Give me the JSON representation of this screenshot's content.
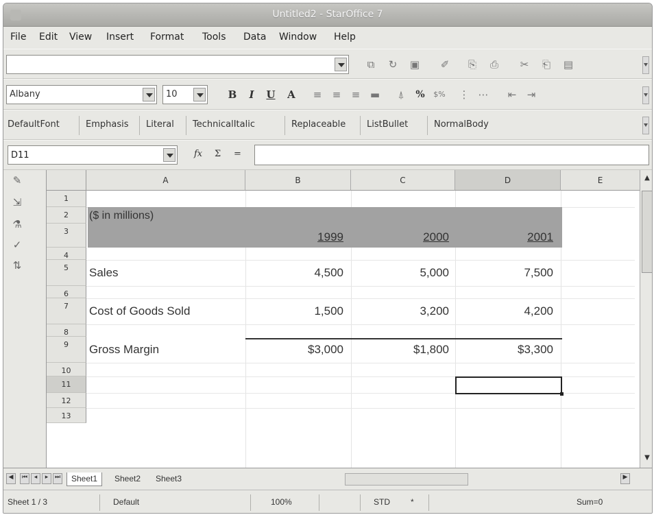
{
  "window": {
    "title": "Untitled2 - StarOffice 7"
  },
  "menu": [
    "File",
    "Edit",
    "View",
    "Insert",
    "Format",
    "Tools",
    "Data",
    "Window",
    "Help"
  ],
  "formatting": {
    "font_name": "Albany",
    "font_size": "10",
    "bold": "B",
    "italic": "I",
    "underline": "U"
  },
  "styles": [
    "DefaultFont",
    "Emphasis",
    "Literal",
    "TechnicalItalic",
    "Replaceable",
    "ListBullet",
    "NormalBody"
  ],
  "formula_bar": {
    "cell_ref": "D11",
    "function_label": "fx",
    "sum_label": "Σ",
    "equals_label": "=",
    "content": ""
  },
  "sheet": {
    "columns": [
      "A",
      "B",
      "C",
      "D",
      "E"
    ],
    "selected_column": "D",
    "rows": [
      "1",
      "2",
      "3",
      "4",
      "5",
      "6",
      "7",
      "8",
      "9",
      "10",
      "11",
      "12",
      "13"
    ],
    "selected_row": "11",
    "cells": {
      "A2": "($ in millions)",
      "B3": "1999",
      "C3": "2000",
      "D3": "2001",
      "A5": "Sales",
      "B5": "4,500",
      "C5": "5,000",
      "D5": "7,500",
      "A7": "Cost of Goods Sold",
      "B7": "1,500",
      "C7": "3,200",
      "D7": "4,200",
      "A9": "Gross Margin",
      "B9": "$3,000",
      "C9": "$1,800",
      "D9": "$3,300"
    }
  },
  "tabs": [
    "Sheet1",
    "Sheet2",
    "Sheet3"
  ],
  "active_tab": "Sheet1",
  "status": {
    "sheet": "Sheet 1 / 3",
    "page_style": "Default",
    "zoom": "100%",
    "mode": "STD",
    "modified": "*",
    "sum": "Sum=0"
  },
  "colors": {
    "header_shade": "#a2a2a2",
    "chrome": "#e8e8e4"
  }
}
